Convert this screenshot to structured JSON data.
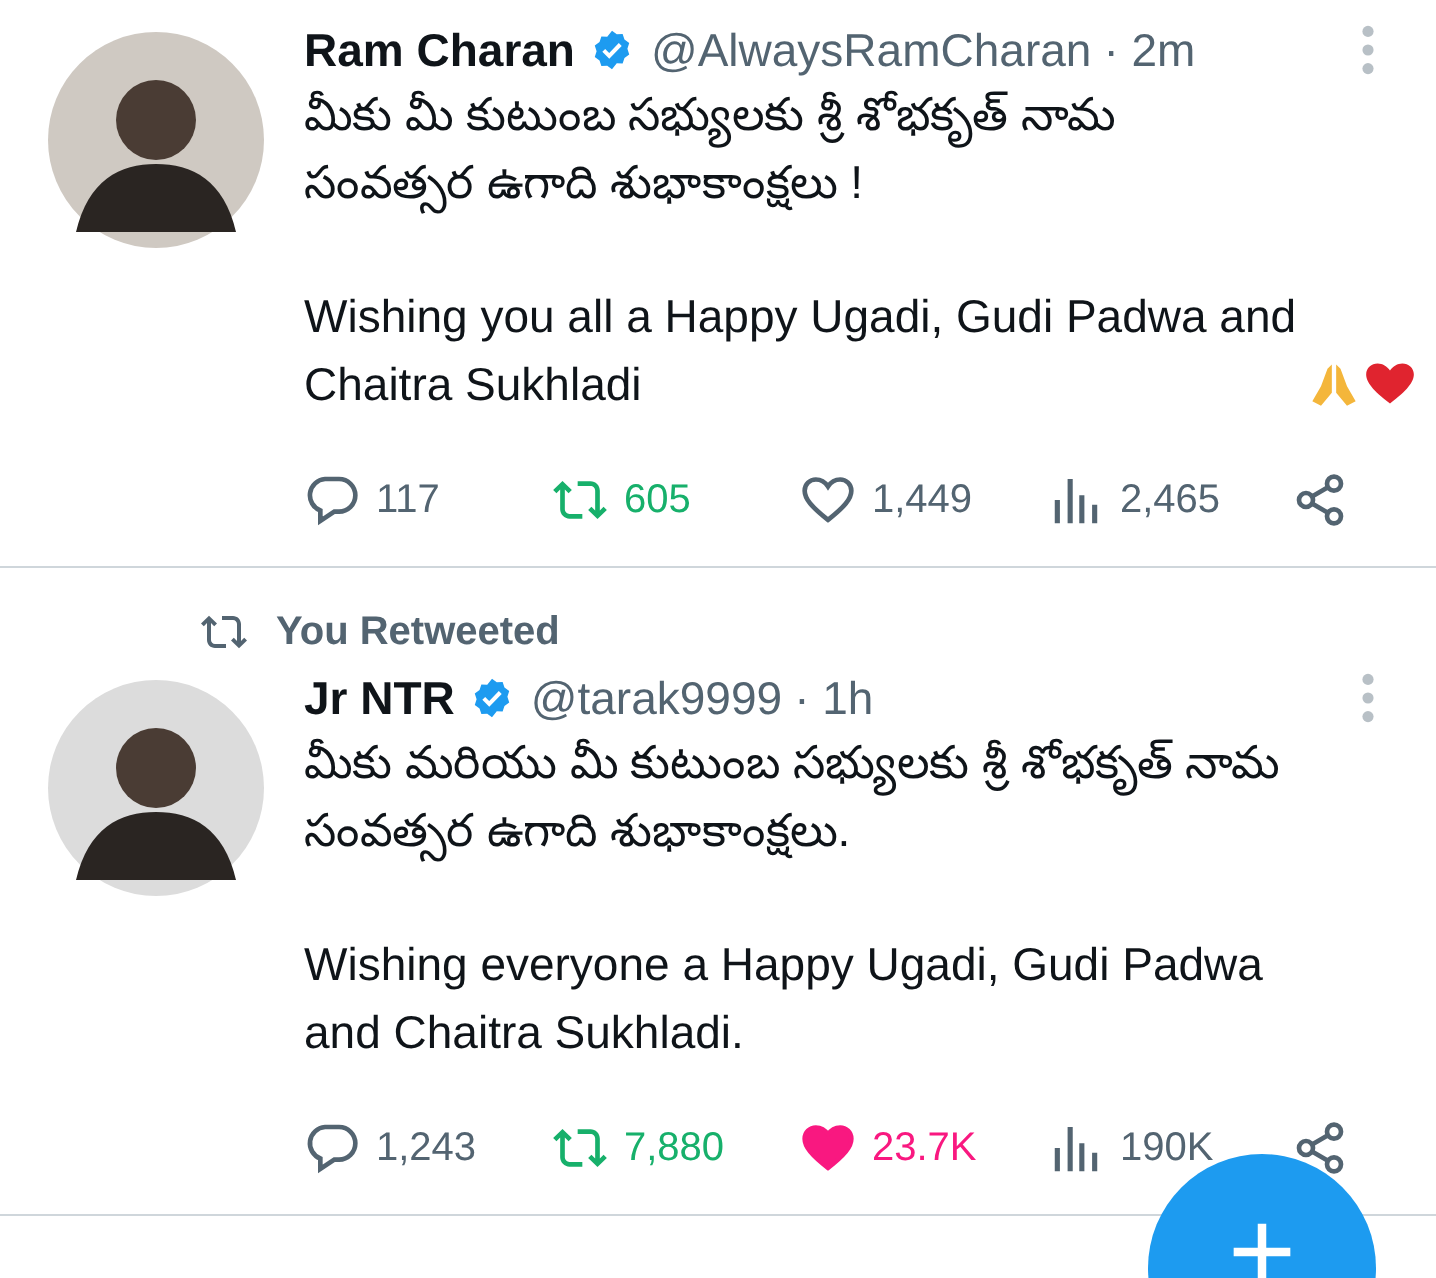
{
  "tweets": [
    {
      "name": "Ram Charan",
      "verified": true,
      "handle": "@AlwaysRamCharan",
      "time": "· 2m",
      "paragraphs": [
        {
          "text": "మీకు మీ కుటుంబ సభ్యులకు  శ్రీ శోభకృత్  నామ సంవత్సర ఉగాది శుభాకాంక్షలు !"
        },
        {
          "text": "Wishing you all a Happy Ugadi, Gudi Padwa and Chaitra Sukhladi",
          "emoji": true
        }
      ],
      "actions": [
        {
          "kind": "reply",
          "count": "117"
        },
        {
          "kind": "retweet",
          "count": "605",
          "on": true
        },
        {
          "kind": "like",
          "count": "1,449",
          "on": false
        },
        {
          "kind": "views",
          "count": "2,465"
        },
        {
          "kind": "share"
        }
      ]
    },
    {
      "retweet_context": "You Retweeted",
      "name": "Jr NTR",
      "verified": true,
      "handle": "@tarak9999",
      "time": "· 1h",
      "paragraphs": [
        {
          "text": "మీకు మరియు మీ కుటుంబ సభ్యులకు శ్రీ శోభకృత్ నామ సంవత్సర ఉగాది శుభాకాంక్షలు."
        },
        {
          "text": "Wishing everyone a Happy Ugadi, Gudi Padwa and Chaitra Sukhladi."
        }
      ],
      "actions": [
        {
          "kind": "reply",
          "count": "1,243"
        },
        {
          "kind": "retweet",
          "count": "7,880",
          "on": true
        },
        {
          "kind": "like",
          "count": "23.7K",
          "on": true
        },
        {
          "kind": "views",
          "count": "190K"
        },
        {
          "kind": "share"
        }
      ]
    }
  ]
}
